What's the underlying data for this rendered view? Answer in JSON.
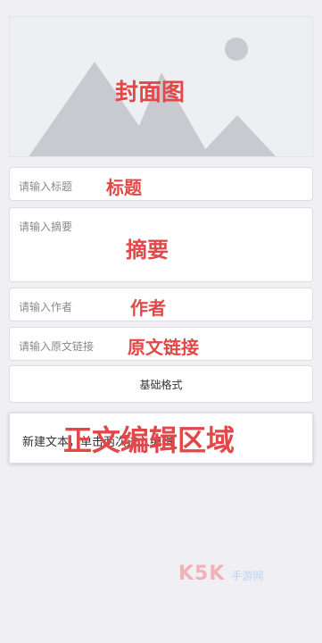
{
  "cover": {
    "label": "封面图"
  },
  "fields": [
    {
      "placeholder": "请输入标题",
      "label": "标题"
    },
    {
      "placeholder": "请输入摘要",
      "label": "摘要"
    },
    {
      "placeholder": "请输入作者",
      "label": "作者"
    },
    {
      "placeholder": "请输入原文链接",
      "label": "原文链接"
    }
  ],
  "format_button": {
    "label": "基础格式"
  },
  "editor": {
    "placeholder": "新建文本，单击两次进入编辑",
    "label": "正文编辑区域"
  },
  "watermark": {
    "brand": "K5K",
    "tag": "手游网"
  },
  "colors": {
    "annotation": "#e24848",
    "background": "#f0eff4"
  }
}
